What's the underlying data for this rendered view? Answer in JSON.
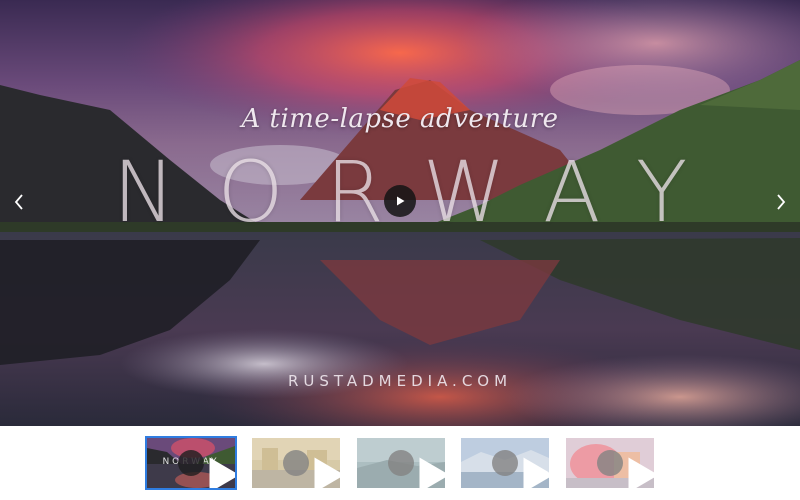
{
  "hero": {
    "subtitle": "A time-lapse adventure",
    "title": "NORWAY",
    "credit": "RUSTADMEDIA.COM"
  },
  "controls": {
    "prev_icon": "chevron-left-icon",
    "next_icon": "chevron-right-icon",
    "play_icon": "play-icon"
  },
  "thumbnails": [
    {
      "label": "NORWAY",
      "active": true
    },
    {
      "label": "",
      "active": false
    },
    {
      "label": "",
      "active": false
    },
    {
      "label": "",
      "active": false
    },
    {
      "label": "",
      "active": false
    }
  ],
  "colors": {
    "active_border": "#2f7de1",
    "play_bg": "#141414"
  }
}
